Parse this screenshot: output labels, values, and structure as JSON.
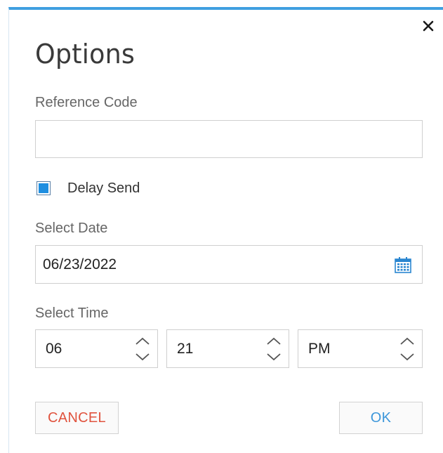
{
  "dialog": {
    "title": "Options",
    "close_glyph": "×"
  },
  "reference_code": {
    "label": "Reference Code",
    "value": "",
    "placeholder": ""
  },
  "delay_send": {
    "label": "Delay Send",
    "checked": true
  },
  "select_date": {
    "label": "Select Date",
    "value": "06/23/2022",
    "icon": "calendar-icon"
  },
  "select_time": {
    "label": "Select Time",
    "hour": "06",
    "minute": "21",
    "period": "PM"
  },
  "buttons": {
    "cancel_label": "CANCEL",
    "ok_label": "OK"
  },
  "colors": {
    "accent": "#3f9fe0",
    "checkbox": "#1e8ee0",
    "cancel_text": "#e0533e",
    "ok_text": "#3d97da"
  }
}
